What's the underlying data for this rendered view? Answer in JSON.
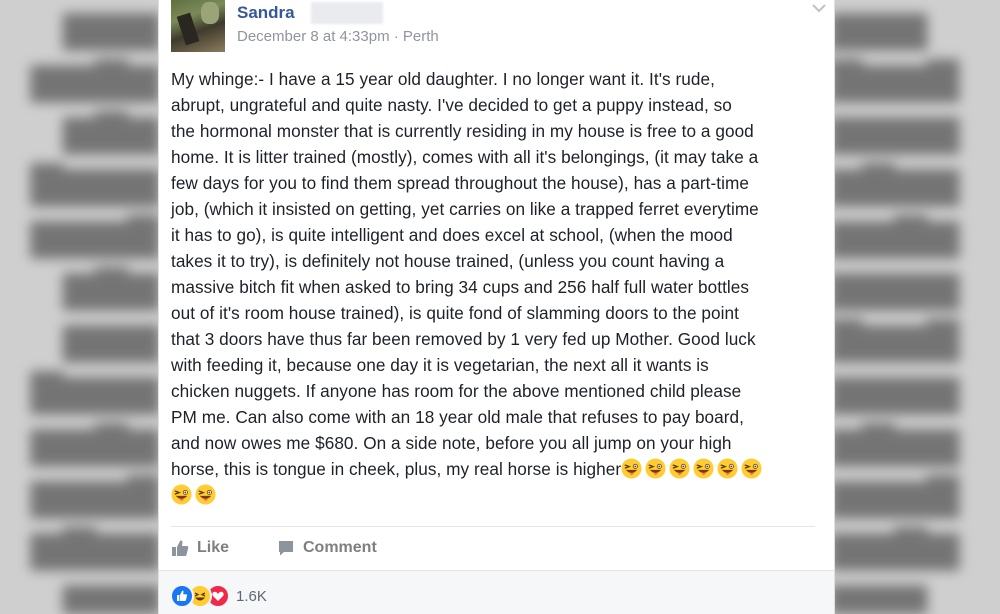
{
  "post": {
    "author_name": "Sandra",
    "timestamp": "December 8 at 4:33pm",
    "separator": "·",
    "location": "Perth",
    "body_lines": [
      "My whinge:- I have a 15 year old daughter. I no longer want it. It's rude,",
      "abrupt, ungrateful and quite nasty. I've decided to get a puppy instead, so",
      "the hormonal monster that is currently residing in my house is free to a good",
      "home. It is litter trained (mostly), comes with all it's belongings, (it may take a",
      "few days for you to find them spread throughout the house), has a part-time",
      "job, (which it insisted on getting, yet carries on like a trapped ferret everytime",
      "it has to go), is quite intelligent and does excel at school, (when the mood",
      "takes it to try), is definitely not house trained, (unless you count having a",
      "massive bitch fit when asked to bring 34 cups and 256 half full water bottles",
      "out of it's room house trained), is quite fond of slamming doors to the point",
      "that 3 doors have thus far been removed by 1 very fed up Mother. Good luck",
      "with feeding it, because one day it is vegetarian, the next all it wants is",
      "chicken nuggets. If anyone has room for the above mentioned child please",
      "PM me. Can also come with an 18 year old male that refuses to pay board,",
      "and now owes me $680. On a side note, before you all jump on your high",
      "horse, this is tongue in cheek, plus, my real horse is higher"
    ],
    "emoji_name": "tongue-out-wink-emoji"
  },
  "actions": {
    "like_label": "Like",
    "comment_label": "Comment"
  },
  "reactions": {
    "types": [
      "like-reaction",
      "haha-reaction",
      "love-reaction"
    ],
    "count": "1.6K"
  },
  "colors": {
    "author_link": "#365899",
    "meta": "#90949c",
    "body": "#1d2129",
    "action": "#7f7f7f",
    "like_blue": "#1877f2",
    "love_red": "#f0284a",
    "emoji_yellow": "#ffcc33"
  }
}
